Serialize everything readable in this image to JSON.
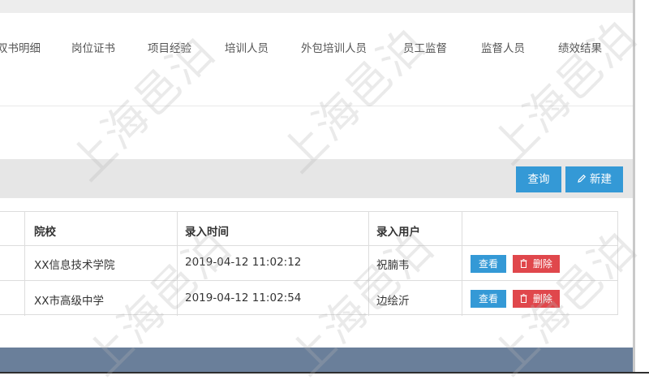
{
  "tabs": [
    "双书明细",
    "岗位证书",
    "项目经验",
    "培训人员",
    "外包培训人员",
    "员工监督",
    "监督人员",
    "绩效结果"
  ],
  "toolbar": {
    "query_label": "查询",
    "new_label": "新建"
  },
  "table": {
    "headers": {
      "school": "院校",
      "entry_time": "录入时间",
      "entry_user": "录入用户"
    },
    "rows": [
      {
        "school": "XX信息技术学院",
        "entry_time": "2019-04-12 11:02:12",
        "entry_user": "祝腩韦",
        "view_label": "查看",
        "delete_label": "删除"
      },
      {
        "school": "XX市高级中学",
        "entry_time": "2019-04-12 11:02:54",
        "entry_user": "边绘沂",
        "view_label": "查看",
        "delete_label": "删除"
      }
    ]
  },
  "watermark": "上海邑泊",
  "colors": {
    "primary": "#3499d6",
    "danger": "#e0474c",
    "footer": "#6a7f9a",
    "toolbar_bg": "#e6e6e6"
  }
}
